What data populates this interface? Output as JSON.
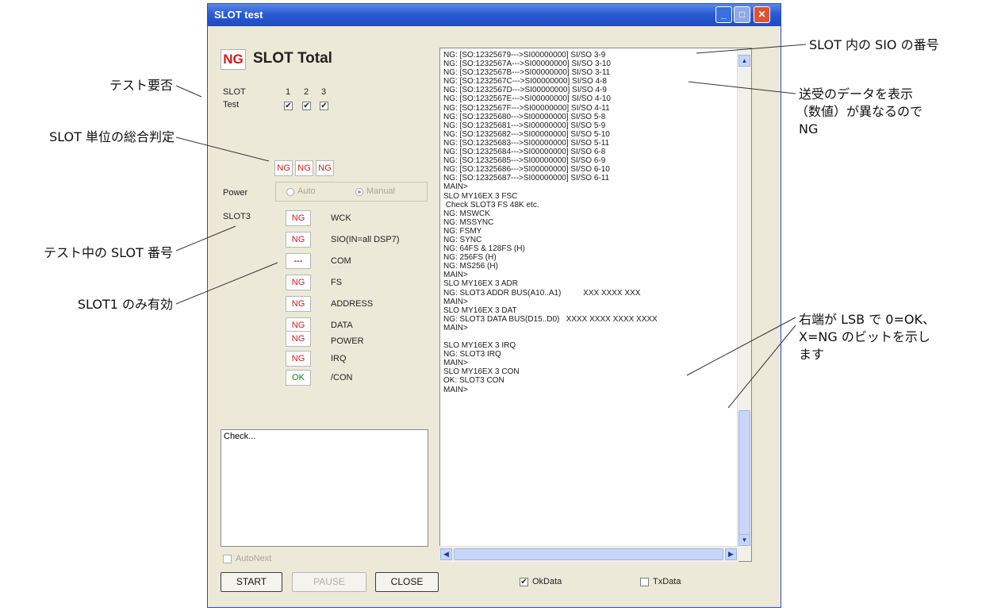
{
  "annotations": {
    "sio_number": "SLOT 内の SIO の番号",
    "send_recv_line1": "送受のデータを表示",
    "send_recv_line2": "（数値）が異なるので",
    "send_recv_line3": "NG",
    "test_needed": "テスト要否",
    "slot_total_judge": "SLOT 単位の総合判定",
    "testing_slot": "テスト中の SLOT 番号",
    "slot1_only": "SLOT1 のみ有効",
    "lsb_line1": "右端が LSB で 0=OK、",
    "lsb_line2": "X=NG のビットを示し",
    "lsb_line3": "ます"
  },
  "window": {
    "title": "SLOT test",
    "min_icon": "minimize-icon",
    "max_icon": "maximize-icon",
    "close_icon": "close-icon"
  },
  "total": {
    "result": "NG",
    "label": "SLOT Total"
  },
  "slot_select": {
    "slot_label": "SLOT",
    "test_label": "Test",
    "numbers": [
      "1",
      "2",
      "3"
    ],
    "checked": [
      true,
      true,
      true
    ],
    "check_mark": "✔"
  },
  "slot_results": [
    "NG",
    "NG",
    "NG"
  ],
  "power": {
    "label": "Power",
    "auto": "Auto",
    "manual": "Manual",
    "selected": "Manual"
  },
  "current_slot": "SLOT3",
  "tests": [
    {
      "result": "NG",
      "name": "WCK"
    },
    {
      "result": "NG",
      "name": "SIO(IN=all DSP7)"
    },
    {
      "result": "---",
      "name": "COM"
    },
    {
      "result": "NG",
      "name": "FS"
    },
    {
      "result": "NG",
      "name": "ADDRESS"
    },
    {
      "result": "NG",
      "name": "DATA"
    },
    {
      "result": "NG",
      "name": "POWER"
    },
    {
      "result": "NG",
      "name": "IRQ"
    },
    {
      "result": "OK",
      "name": "/CON"
    }
  ],
  "check_text": "Check...",
  "autonext_label": "AutoNext",
  "buttons": {
    "start": "START",
    "pause": "PAUSE",
    "close": "CLOSE"
  },
  "log_lines": [
    "NG: [SO:12325679--->SI00000000] SI/SO 3-9",
    "NG: [SO:1232567A--->SI00000000] SI/SO 3-10",
    "NG: [SO:1232567B--->SI00000000] SI/SO 3-11",
    "NG: [SO:1232567C--->SI00000000] SI/SO 4-8",
    "NG: [SO:1232567D--->SI00000000] SI/SO 4-9",
    "NG: [SO:1232567E--->SI00000000] SI/SO 4-10",
    "NG: [SO:1232567F--->SI00000000] SI/SO 4-11",
    "NG: [SO:12325680--->SI00000000] SI/SO 5-8",
    "NG: [SO:12325681--->SI00000000] SI/SO 5-9",
    "NG: [SO:12325682--->SI00000000] SI/SO 5-10",
    "NG: [SO:12325683--->SI00000000] SI/SO 5-11",
    "NG: [SO:12325684--->SI00000000] SI/SO 6-8",
    "NG: [SO:12325685--->SI00000000] SI/SO 6-9",
    "NG: [SO:12325686--->SI00000000] SI/SO 6-10",
    "NG: [SO:12325687--->SI00000000] SI/SO 6-11",
    "MAIN>",
    "SLO MY16EX 3 FSC",
    " Check SLOT3 FS 48K etc.",
    "NG: MSWCK",
    "NG: MSSYNC",
    "NG: FSMY",
    "NG: SYNC",
    "NG: 64FS & 128FS (H)",
    "NG: 256FS (H)",
    "NG: MS256 (H)",
    "MAIN>",
    "SLO MY16EX 3 ADR",
    "NG: SLOT3 ADDR BUS(A10..A1)          XXX XXXX XXX",
    "MAIN>",
    "SLO MY16EX 3 DAT",
    "NG: SLOT3 DATA BUS(D15..D0)   XXXX XXXX XXXX XXXX",
    "MAIN>",
    "",
    "SLO MY16EX 3 IRQ",
    "NG: SLOT3 IRQ",
    "MAIN>",
    "SLO MY16EX 3 CON",
    "OK: SLOT3 CON",
    "MAIN>"
  ],
  "bottom_checks": {
    "okdata": "OkData",
    "okdata_checked": true,
    "txdata": "TxData",
    "txdata_checked": false
  }
}
